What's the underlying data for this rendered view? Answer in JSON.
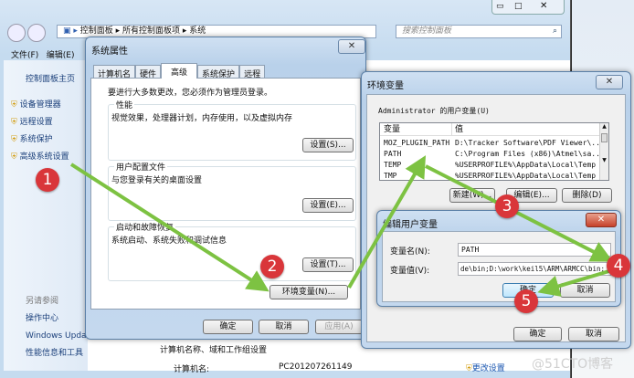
{
  "explorer": {
    "breadcrumb": [
      "控制面板",
      "所有控制面板项",
      "系统"
    ],
    "search_placeholder": "搜索控制面板",
    "menu": [
      "文件(F)",
      "编辑(E)"
    ],
    "sidebar_home": "控制面板主页",
    "sidebar_items": [
      "设备管理器",
      "远程设置",
      "系统保护",
      "高级系统设置"
    ],
    "see_also_heading": "另请参阅",
    "see_also": [
      "操作中心",
      "Windows Upda",
      "性能信息和工具"
    ],
    "section_title": "计算机名称、域和工作组设置",
    "computer_name_label": "计算机名:",
    "computer_name_value": "PC201207261149",
    "change_settings": "更改设置"
  },
  "sysprops": {
    "title": "系统属性",
    "tabs": [
      "计算机名",
      "硬件",
      "高级",
      "系统保护",
      "远程"
    ],
    "active_tab": "高级",
    "note": "要进行大多数更改，您必须作为管理员登录。",
    "groups": [
      {
        "label": "性能",
        "desc": "视觉效果，处理器计划，内存使用，以及虚拟内存",
        "button": "设置(S)..."
      },
      {
        "label": "用户配置文件",
        "desc": "与您登录有关的桌面设置",
        "button": "设置(E)..."
      },
      {
        "label": "启动和故障恢复",
        "desc": "系统启动、系统失败和调试信息",
        "button": "设置(T)..."
      }
    ],
    "env_button": "环境变量(N)...",
    "ok": "确定",
    "cancel": "取消",
    "apply": "应用(A)"
  },
  "envvars": {
    "title": "环境变量",
    "user_vars_label": "Administrator 的用户变量(U)",
    "columns": [
      "变量",
      "值"
    ],
    "rows": [
      [
        "MOZ_PLUGIN_PATH",
        "D:\\Tracker Software\\PDF Viewer\\..."
      ],
      [
        "PATH",
        "C:\\Program Files (x86)\\Atmel\\sa..."
      ],
      [
        "TEMP",
        "%USERPROFILE%\\AppData\\Local\\Temp"
      ],
      [
        "TMP",
        "%USERPROFILE%\\AppData\\Local\\Temp"
      ]
    ],
    "new": "新建(W)...",
    "edit": "编辑(E)...",
    "delete": "删除(D)",
    "ok": "确定",
    "cancel": "取消"
  },
  "editvar": {
    "title": "编辑用户变量",
    "name_label": "变量名(N):",
    "name_value": "PATH",
    "value_label": "变量值(V):",
    "value_value": "de\\bin;D:\\work\\keil5\\ARM\\ARMCC\\bin;",
    "ok": "确定",
    "cancel": "取消"
  },
  "steps": [
    "1",
    "2",
    "3",
    "4",
    "5"
  ],
  "watermark": "@51CTO博客",
  "colors": {
    "arrow": "#7dc242",
    "badge": "#d9363a"
  }
}
